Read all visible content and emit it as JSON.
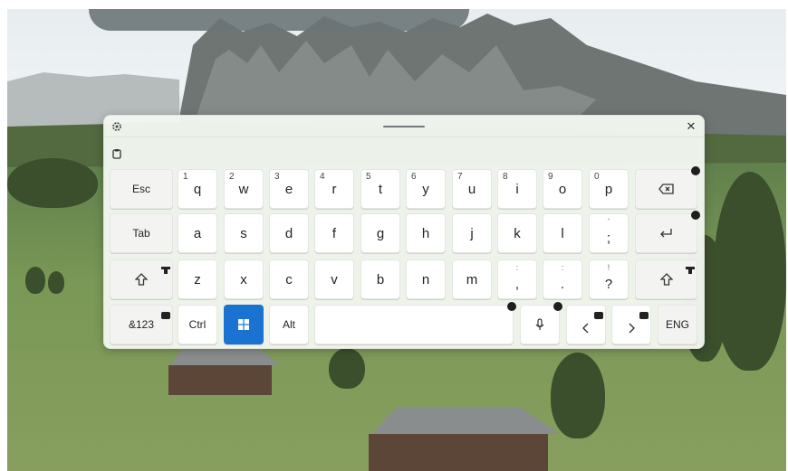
{
  "keyboard": {
    "row1": [
      {
        "label": "Esc"
      },
      {
        "label": "q",
        "num": "1"
      },
      {
        "label": "w",
        "num": "2"
      },
      {
        "label": "e",
        "num": "3"
      },
      {
        "label": "r",
        "num": "4"
      },
      {
        "label": "t",
        "num": "5"
      },
      {
        "label": "y",
        "num": "6"
      },
      {
        "label": "u",
        "num": "7"
      },
      {
        "label": "i",
        "num": "8"
      },
      {
        "label": "o",
        "num": "9"
      },
      {
        "label": "p",
        "num": "0"
      },
      {
        "icon": "backspace-icon"
      }
    ],
    "row2": [
      {
        "label": "Tab"
      },
      {
        "label": "a"
      },
      {
        "label": "s"
      },
      {
        "label": "d"
      },
      {
        "label": "f"
      },
      {
        "label": "g"
      },
      {
        "label": "h"
      },
      {
        "label": "j"
      },
      {
        "label": "k"
      },
      {
        "label": "l"
      },
      {
        "label": ";",
        "alt": "'"
      },
      {
        "icon": "enter-icon"
      }
    ],
    "row3": [
      {
        "icon": "shift-icon"
      },
      {
        "label": "z"
      },
      {
        "label": "x"
      },
      {
        "label": "c"
      },
      {
        "label": "v"
      },
      {
        "label": "b"
      },
      {
        "label": "n"
      },
      {
        "label": "m"
      },
      {
        "label": ",",
        "alt": ":"
      },
      {
        "label": ".",
        "alt": ":"
      },
      {
        "label": "?",
        "alt": "!"
      },
      {
        "icon": "shift-icon"
      }
    ],
    "row4": {
      "symbols": "&123",
      "ctrl": "Ctrl",
      "alt": "Alt",
      "lang": "ENG"
    }
  },
  "colors": {
    "panel_bg": "#f3f7f0",
    "key_bg": "#ffffff",
    "windows_key": "#1a73d1"
  }
}
